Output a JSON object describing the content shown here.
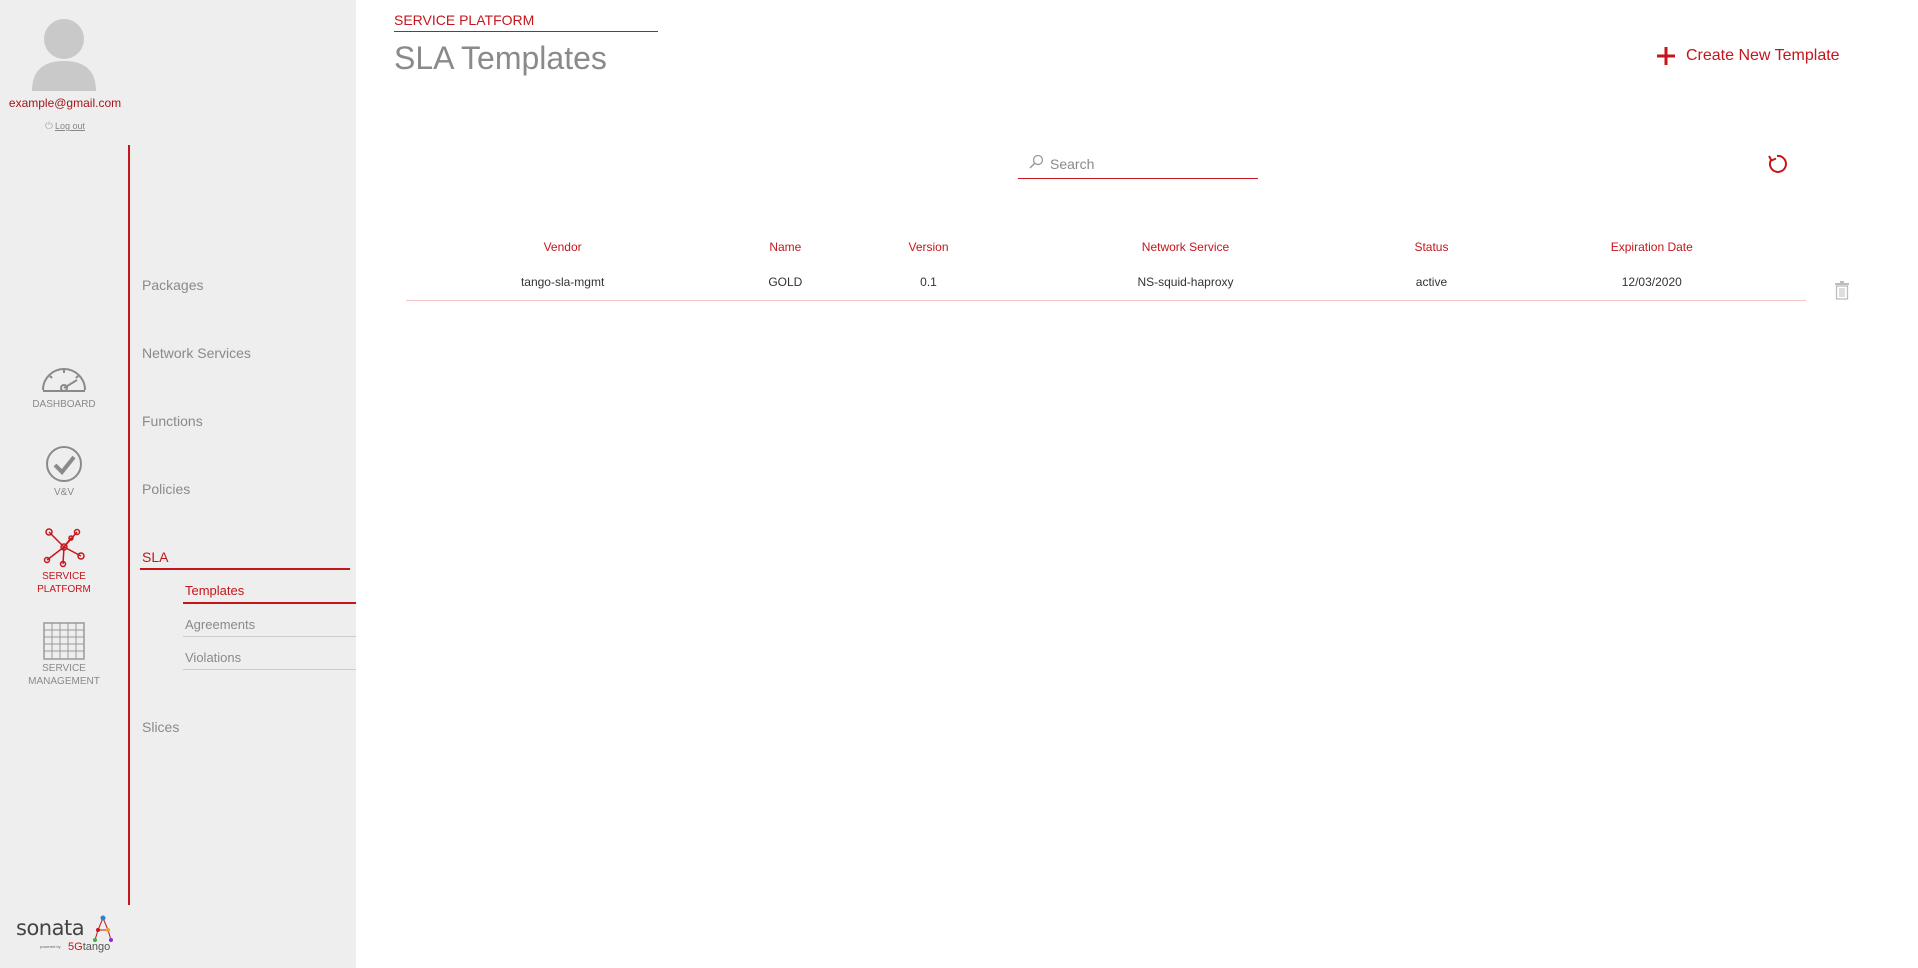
{
  "user": {
    "email": "example@gmail.com",
    "logout_label": "Log out"
  },
  "rail": {
    "items": [
      {
        "label": "DASHBOARD",
        "icon": "gauge-icon"
      },
      {
        "label": "V&V",
        "icon": "check-circle-icon"
      },
      {
        "label": "SERVICE PLATFORM",
        "icon": "network-icon",
        "active": true
      },
      {
        "label": "SERVICE MANAGEMENT",
        "icon": "grid-icon"
      }
    ]
  },
  "logo": {
    "brand": "sonata",
    "powered": "powered by",
    "by_brand_a": "5G",
    "by_brand_b": "tango"
  },
  "nav": {
    "items": [
      "Packages",
      "Network Services",
      "Functions",
      "Policies",
      "SLA",
      "Slices"
    ],
    "sla_sub": [
      "Templates",
      "Agreements",
      "Violations"
    ]
  },
  "header": {
    "kicker": "SERVICE PLATFORM",
    "title": "SLA Templates",
    "create_label": "Create New Template"
  },
  "search": {
    "placeholder": "Search",
    "value": ""
  },
  "table": {
    "columns": [
      "Vendor",
      "Name",
      "Version",
      "Network Service",
      "Status",
      "Expiration Date"
    ],
    "rows": [
      [
        "tango-sla-mgmt",
        "GOLD",
        "0.1",
        "NS-squid-haproxy",
        "active",
        "12/03/2020"
      ]
    ]
  },
  "colors": {
    "accent": "#c4161c",
    "muted": "#8a8a8a",
    "panel": "#eeeeee"
  }
}
